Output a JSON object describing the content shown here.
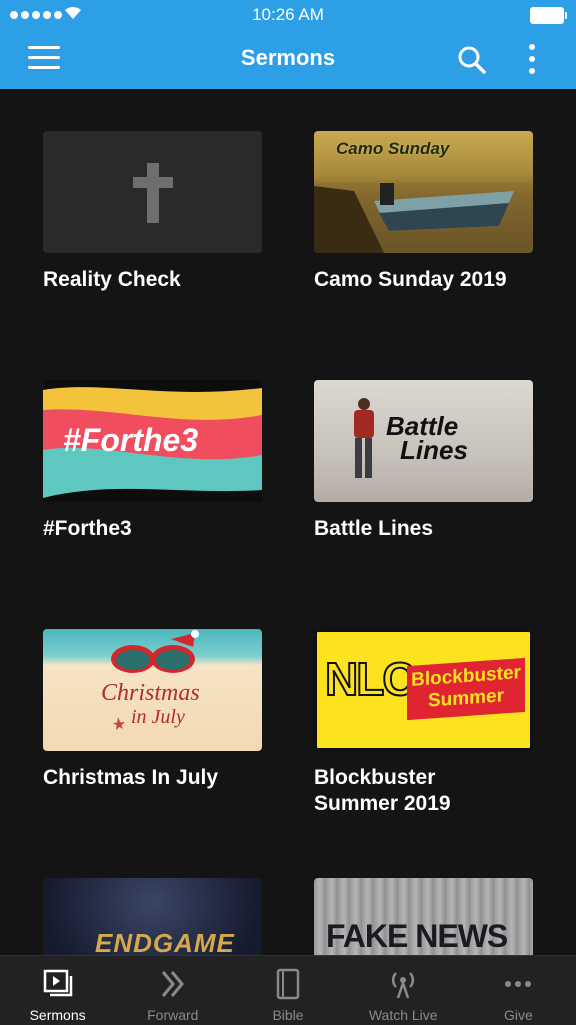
{
  "status": {
    "time": "10:26 AM"
  },
  "header": {
    "title": "Sermons"
  },
  "sermons": [
    {
      "title": "Reality Check"
    },
    {
      "title": "Camo Sunday 2019",
      "thumb_text": "Camo Sunday"
    },
    {
      "title": "#Forthe3",
      "thumb_text": "#Forthe3"
    },
    {
      "title": "Battle Lines",
      "thumb_text_1": "Battle",
      "thumb_text_2": "Lines"
    },
    {
      "title": "Christmas In July",
      "thumb_text_1": "Christmas",
      "thumb_text_2": "in July"
    },
    {
      "title": "Blockbuster Summer 2019",
      "thumb_text_1": "NLC",
      "thumb_text_2": "Blockbuster",
      "thumb_text_3": "Summer"
    },
    {
      "title": "",
      "thumb_text": "ENDGAME"
    },
    {
      "title": "",
      "thumb_text": "FAKE NEWS"
    }
  ],
  "tabs": [
    {
      "label": "Sermons",
      "icon": "sermons-icon",
      "active": true
    },
    {
      "label": "Forward",
      "icon": "chevrons-right-icon"
    },
    {
      "label": "Bible",
      "icon": "book-icon"
    },
    {
      "label": "Watch Live",
      "icon": "broadcast-icon"
    },
    {
      "label": "Give",
      "icon": "more-horizontal-icon"
    }
  ],
  "colors": {
    "header": "#2d9fe6",
    "background": "#141414",
    "tabbar": "#222222"
  }
}
